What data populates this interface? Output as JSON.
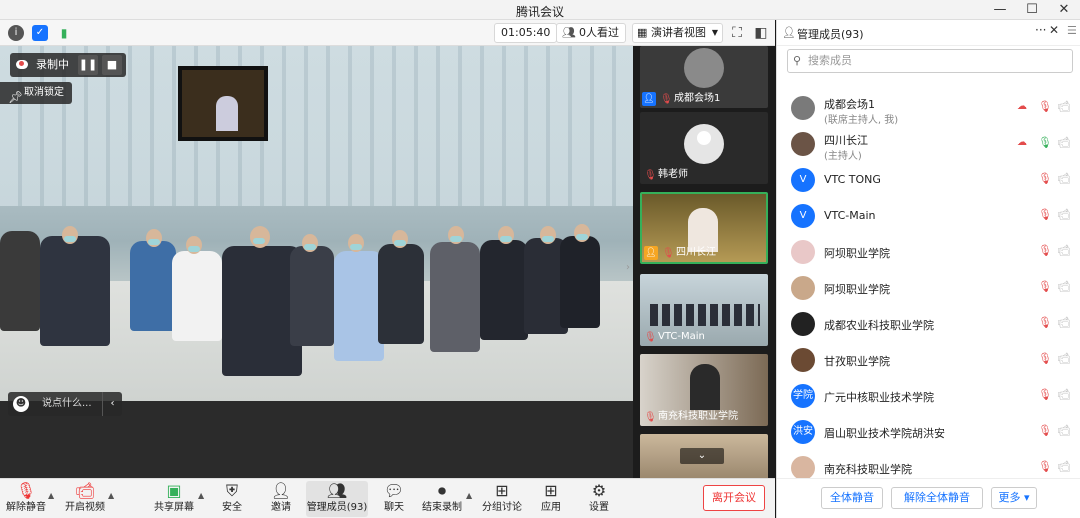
{
  "window": {
    "title": "腾讯会议",
    "minimize": "—",
    "maximize": "☐",
    "close": "✕"
  },
  "topbar": {
    "info_icon": "i",
    "shield_icon": "✓",
    "signal_icon": "▮",
    "timer": "01:05:40",
    "viewers": "0人看过",
    "view_mode": "演讲者视图",
    "fullscreen": "⛶",
    "layout": "◧"
  },
  "recording": {
    "label": "录制中",
    "pause": "❚❚",
    "stop": "■"
  },
  "unpin": {
    "label": "取消锁定"
  },
  "chat_input": {
    "placeholder": "说点什么...",
    "emoji": "☻",
    "collapse": "‹"
  },
  "thumbnails": [
    {
      "name": "成都会场1",
      "badge": "host",
      "active": false
    },
    {
      "name": "韩老师",
      "badge": "mic",
      "active": false
    },
    {
      "name": "四川长江",
      "badge": "host",
      "active": true
    },
    {
      "name": "VTC-Main",
      "badge": "mic",
      "active": false
    },
    {
      "name": "南充科技职业学院",
      "badge": "mic",
      "active": false
    },
    {
      "name": "",
      "badge": "none",
      "active": false
    }
  ],
  "toolbar": {
    "unmute": "解除静音",
    "video": "开启视频",
    "share": "共享屏幕",
    "security": "安全",
    "invite": "邀请",
    "members": "管理成员(93)",
    "chat": "聊天",
    "stop_record": "结束录制",
    "breakout": "分组讨论",
    "apps": "应用",
    "settings": "设置",
    "leave": "离开会议"
  },
  "panel": {
    "title": "管理成员(93)",
    "search_placeholder": "搜索成员",
    "members": [
      {
        "name": "成都会场1",
        "sub": "(联席主持人, 我)",
        "avatar": "",
        "color": "#7a7a7a",
        "rec": true,
        "mic": "muted"
      },
      {
        "name": "四川长江",
        "sub": "(主持人)",
        "avatar": "",
        "color": "#6b5446",
        "rec": true,
        "mic": "on"
      },
      {
        "name": "VTC TONG",
        "sub": "",
        "avatar": "V",
        "color": "#1673ff",
        "rec": false,
        "mic": "muted"
      },
      {
        "name": "VTC-Main",
        "sub": "",
        "avatar": "V",
        "color": "#1673ff",
        "rec": false,
        "mic": "muted"
      },
      {
        "name": "阿坝职业学院",
        "sub": "",
        "avatar": "",
        "color": "#e9c8c8",
        "rec": false,
        "mic": "muted"
      },
      {
        "name": "阿坝职业学院",
        "sub": "",
        "avatar": "",
        "color": "#c9a88a",
        "rec": false,
        "mic": "muted"
      },
      {
        "name": "成都农业科技职业学院",
        "sub": "",
        "avatar": "",
        "color": "#222222",
        "rec": false,
        "mic": "muted"
      },
      {
        "name": "甘孜职业学院",
        "sub": "",
        "avatar": "",
        "color": "#6b4a33",
        "rec": false,
        "mic": "muted"
      },
      {
        "name": "广元中核职业技术学院",
        "sub": "",
        "avatar": "学院",
        "color": "#1673ff",
        "rec": false,
        "mic": "muted"
      },
      {
        "name": "眉山职业技术学院胡洪安",
        "sub": "",
        "avatar": "洪安",
        "color": "#1673ff",
        "rec": false,
        "mic": "muted"
      },
      {
        "name": "南充科技职业学院",
        "sub": "",
        "avatar": "",
        "color": "#d9b6a0",
        "rec": false,
        "mic": "muted"
      }
    ],
    "mute_all": "全体静音",
    "unmute_all": "解除全体静音",
    "more": "更多 ▾"
  }
}
